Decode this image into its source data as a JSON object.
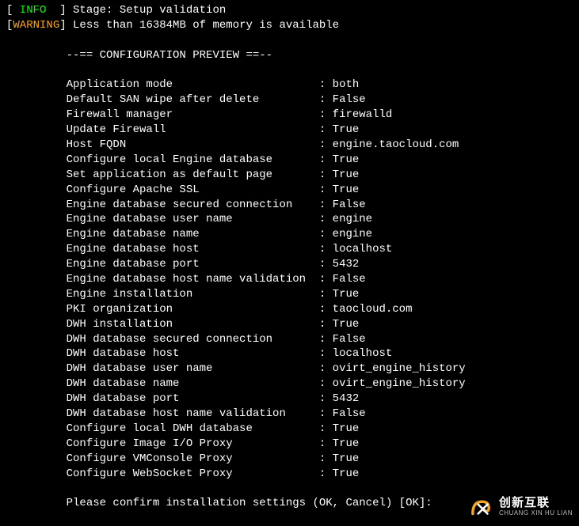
{
  "log": {
    "info_tag": " INFO  ",
    "warn_tag": "WARNING",
    "info_msg": "Stage: Setup validation",
    "warn_msg": "Less than 16384MB of memory is available"
  },
  "section_header": "--== CONFIGURATION PREVIEW ==--",
  "config": [
    {
      "label": "Application mode",
      "value": "both"
    },
    {
      "label": "Default SAN wipe after delete",
      "value": "False"
    },
    {
      "label": "Firewall manager",
      "value": "firewalld"
    },
    {
      "label": "Update Firewall",
      "value": "True"
    },
    {
      "label": "Host FQDN",
      "value": "engine.taocloud.com"
    },
    {
      "label": "Configure local Engine database",
      "value": "True"
    },
    {
      "label": "Set application as default page",
      "value": "True"
    },
    {
      "label": "Configure Apache SSL",
      "value": "True"
    },
    {
      "label": "Engine database secured connection",
      "value": "False"
    },
    {
      "label": "Engine database user name",
      "value": "engine"
    },
    {
      "label": "Engine database name",
      "value": "engine"
    },
    {
      "label": "Engine database host",
      "value": "localhost"
    },
    {
      "label": "Engine database port",
      "value": "5432"
    },
    {
      "label": "Engine database host name validation",
      "value": "False"
    },
    {
      "label": "Engine installation",
      "value": "True"
    },
    {
      "label": "PKI organization",
      "value": "taocloud.com"
    },
    {
      "label": "DWH installation",
      "value": "True"
    },
    {
      "label": "DWH database secured connection",
      "value": "False"
    },
    {
      "label": "DWH database host",
      "value": "localhost"
    },
    {
      "label": "DWH database user name",
      "value": "ovirt_engine_history"
    },
    {
      "label": "DWH database name",
      "value": "ovirt_engine_history"
    },
    {
      "label": "DWH database port",
      "value": "5432"
    },
    {
      "label": "DWH database host name validation",
      "value": "False"
    },
    {
      "label": "Configure local DWH database",
      "value": "True"
    },
    {
      "label": "Configure Image I/O Proxy",
      "value": "True"
    },
    {
      "label": "Configure VMConsole Proxy",
      "value": "True"
    },
    {
      "label": "Configure WebSocket Proxy",
      "value": "True"
    }
  ],
  "prompt": "Please confirm installation settings (OK, Cancel) [OK]:",
  "branding": {
    "cn": "创新互联",
    "en": "CHUANG XIN HU LIAN"
  }
}
